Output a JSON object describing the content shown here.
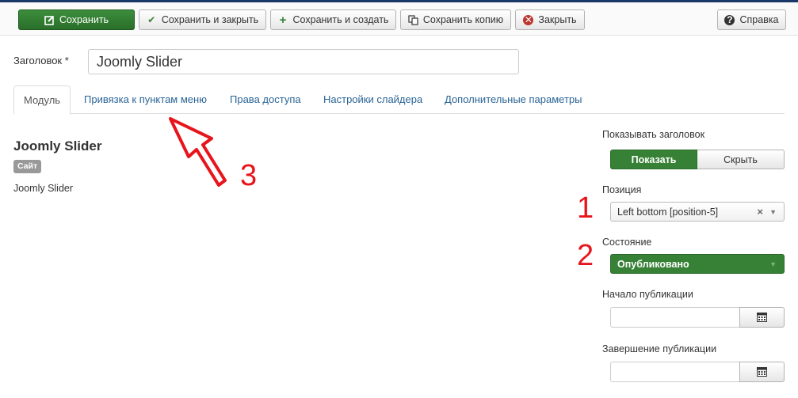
{
  "toolbar": {
    "save": "Сохранить",
    "save_close": "Сохранить и закрыть",
    "save_new": "Сохранить и создать",
    "save_copy": "Сохранить копию",
    "close": "Закрыть",
    "help": "Справка"
  },
  "form": {
    "title_label": "Заголовок",
    "required_mark": "*",
    "title_value": "Joomly Slider"
  },
  "tabs": [
    {
      "label": "Модуль",
      "active": true
    },
    {
      "label": "Привязка к пунктам меню",
      "active": false
    },
    {
      "label": "Права доступа",
      "active": false
    },
    {
      "label": "Настройки слайдера",
      "active": false
    },
    {
      "label": "Дополнительные параметры",
      "active": false
    }
  ],
  "module": {
    "name": "Joomly Slider",
    "badge": "Сайт",
    "description": "Joomly Slider"
  },
  "sidebar": {
    "show_title_label": "Показывать заголовок",
    "show_label": "Показать",
    "hide_label": "Скрыть",
    "position_label": "Позиция",
    "position_value": "Left bottom [position-5]",
    "state_label": "Состояние",
    "state_value": "Опубликовано",
    "publish_up_label": "Начало публикации",
    "publish_up_value": "",
    "publish_down_label": "Завершение публикации",
    "publish_down_value": ""
  },
  "annotations": {
    "n1": "1",
    "n2": "2",
    "n3": "3"
  },
  "colors": {
    "primary_green": "#378137",
    "link_blue": "#2a6496",
    "annotation_red": "#e8141b",
    "topbar": "#1a3867"
  },
  "icons": {
    "save": "edit-icon",
    "save_close": "check-icon",
    "save_new": "plus-icon",
    "save_copy": "copy-icon",
    "close": "close-circle-icon",
    "help": "help-circle-icon",
    "calendar": "calendar-icon"
  }
}
